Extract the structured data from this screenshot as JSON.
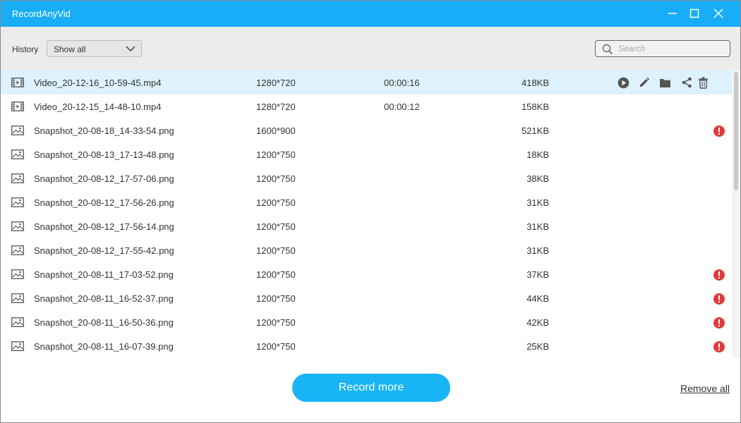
{
  "window": {
    "title": "RecordAnyVid",
    "controls": [
      "minimize-icon",
      "maximize-icon",
      "close-icon"
    ]
  },
  "toolbar": {
    "history_label": "History",
    "filter": {
      "selected": "Show all"
    },
    "search": {
      "placeholder": "Search",
      "value": ""
    }
  },
  "files": [
    {
      "type": "video",
      "name": "Video_20-12-16_10-59-45.mp4",
      "resolution": "1280*720",
      "duration": "00:00:16",
      "size": "418KB",
      "warning": false,
      "selected": true
    },
    {
      "type": "video",
      "name": "Video_20-12-15_14-48-10.mp4",
      "resolution": "1280*720",
      "duration": "00:00:12",
      "size": "158KB",
      "warning": false,
      "selected": false
    },
    {
      "type": "image",
      "name": "Snapshot_20-08-18_14-33-54.png",
      "resolution": "1600*900",
      "duration": "",
      "size": "521KB",
      "warning": true,
      "selected": false
    },
    {
      "type": "image",
      "name": "Snapshot_20-08-13_17-13-48.png",
      "resolution": "1200*750",
      "duration": "",
      "size": "18KB",
      "warning": false,
      "selected": false
    },
    {
      "type": "image",
      "name": "Snapshot_20-08-12_17-57-06.png",
      "resolution": "1200*750",
      "duration": "",
      "size": "38KB",
      "warning": false,
      "selected": false
    },
    {
      "type": "image",
      "name": "Snapshot_20-08-12_17-56-26.png",
      "resolution": "1200*750",
      "duration": "",
      "size": "31KB",
      "warning": false,
      "selected": false
    },
    {
      "type": "image",
      "name": "Snapshot_20-08-12_17-56-14.png",
      "resolution": "1200*750",
      "duration": "",
      "size": "31KB",
      "warning": false,
      "selected": false
    },
    {
      "type": "image",
      "name": "Snapshot_20-08-12_17-55-42.png",
      "resolution": "1200*750",
      "duration": "",
      "size": "31KB",
      "warning": false,
      "selected": false
    },
    {
      "type": "image",
      "name": "Snapshot_20-08-11_17-03-52.png",
      "resolution": "1200*750",
      "duration": "",
      "size": "37KB",
      "warning": true,
      "selected": false
    },
    {
      "type": "image",
      "name": "Snapshot_20-08-11_16-52-37.png",
      "resolution": "1200*750",
      "duration": "",
      "size": "44KB",
      "warning": true,
      "selected": false
    },
    {
      "type": "image",
      "name": "Snapshot_20-08-11_16-50-36.png",
      "resolution": "1200*750",
      "duration": "",
      "size": "42KB",
      "warning": true,
      "selected": false
    },
    {
      "type": "image",
      "name": "Snapshot_20-08-11_16-07-39.png",
      "resolution": "1200*750",
      "duration": "",
      "size": "25KB",
      "warning": true,
      "selected": false
    }
  ],
  "row_actions": [
    "play-icon",
    "edit-icon",
    "folder-icon",
    "share-icon",
    "delete-icon"
  ],
  "footer": {
    "record_more_label": "Record more",
    "remove_all_label": "Remove all"
  },
  "colors": {
    "accent": "#18aef7",
    "selected_row": "#ddf2fd",
    "warning": "#e03a3e",
    "toolbar_bg": "#ececec"
  }
}
